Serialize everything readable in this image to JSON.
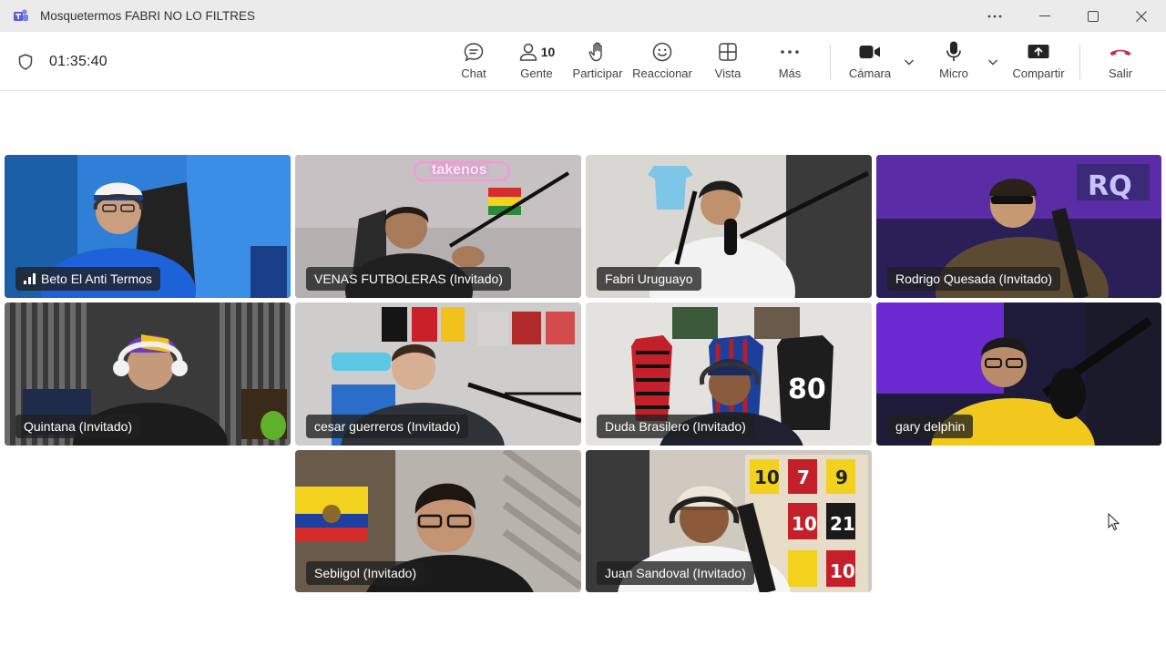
{
  "window": {
    "title": "Mosquetermos FABRI NO LO FILTRES",
    "more_icon": "ellipsis-icon",
    "minimize_icon": "minimize-icon",
    "maximize_icon": "maximize-icon",
    "close_icon": "close-icon"
  },
  "meeting": {
    "timer": "01:35:40"
  },
  "toolbar": {
    "chat": "Chat",
    "people": "Gente",
    "people_count": "10",
    "raise_hand": "Participar",
    "react": "Reaccionar",
    "view": "Vista",
    "more": "Más",
    "camera": "Cámara",
    "mic": "Micro",
    "share": "Compartir",
    "leave": "Salir"
  },
  "colors": {
    "accent": "#6264a7",
    "leave": "#c4314b"
  },
  "participants": [
    {
      "name": "Beto El Anti Termos",
      "speaking": false,
      "signal": true
    },
    {
      "name": "VENAS FUTBOLERAS (Invitado)",
      "speaking": true,
      "sign_text": "takenos"
    },
    {
      "name": "Fabri Uruguayo",
      "speaking": false
    },
    {
      "name": "Rodrigo Quesada (Invitado)",
      "speaking": true
    },
    {
      "name": "Quintana (Invitado)",
      "speaking": false
    },
    {
      "name": "cesar guerreros (Invitado)",
      "speaking": false
    },
    {
      "name": "Duda Brasilero (Invitado)",
      "speaking": false
    },
    {
      "name": "gary delphin",
      "speaking": true
    },
    {
      "name": "Sebiigol (Invitado)",
      "speaking": false
    },
    {
      "name": "Juan Sandoval (Invitado)",
      "speaking": false
    }
  ]
}
